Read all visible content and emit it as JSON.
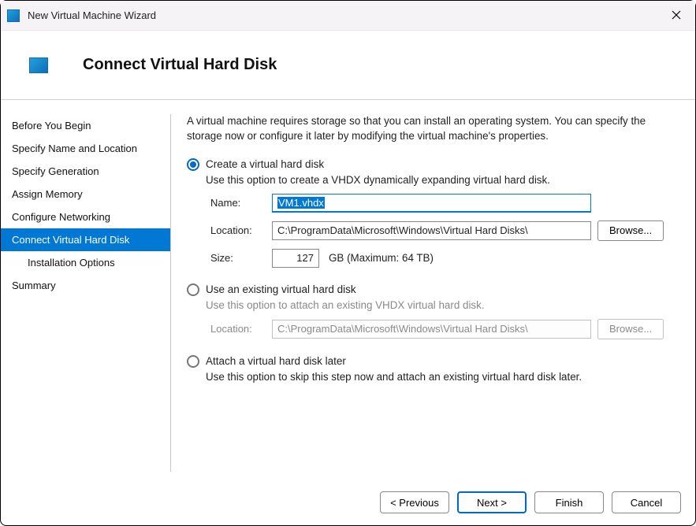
{
  "window": {
    "title": "New Virtual Machine Wizard"
  },
  "header": {
    "title": "Connect Virtual Hard Disk"
  },
  "sidebar": {
    "steps": [
      "Before You Begin",
      "Specify Name and Location",
      "Specify Generation",
      "Assign Memory",
      "Configure Networking",
      "Connect Virtual Hard Disk",
      "Installation Options",
      "Summary"
    ],
    "selectedIndex": 5,
    "indentIndex": 6
  },
  "content": {
    "intro": "A virtual machine requires storage so that you can install an operating system. You can specify the storage now or configure it later by modifying the virtual machine's properties.",
    "option1": {
      "label": "Create a virtual hard disk",
      "desc": "Use this option to create a VHDX dynamically expanding virtual hard disk.",
      "name_label": "Name:",
      "name_value": "VM1.vhdx",
      "location_label": "Location:",
      "location_value": "C:\\ProgramData\\Microsoft\\Windows\\Virtual Hard Disks\\",
      "browse_label": "Browse...",
      "size_label": "Size:",
      "size_value": "127",
      "size_suffix": "GB (Maximum: 64 TB)"
    },
    "option2": {
      "label": "Use an existing virtual hard disk",
      "desc": "Use this option to attach an existing VHDX virtual hard disk.",
      "location_label": "Location:",
      "location_value": "C:\\ProgramData\\Microsoft\\Windows\\Virtual Hard Disks\\",
      "browse_label": "Browse..."
    },
    "option3": {
      "label": "Attach a virtual hard disk later",
      "desc": "Use this option to skip this step now and attach an existing virtual hard disk later."
    }
  },
  "footer": {
    "previous": "< Previous",
    "next": "Next >",
    "finish": "Finish",
    "cancel": "Cancel"
  }
}
